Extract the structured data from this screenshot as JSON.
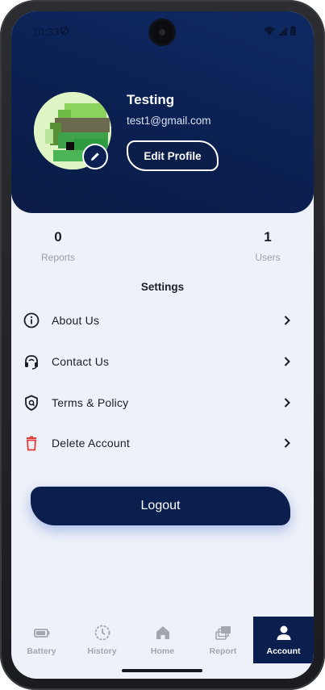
{
  "status_bar": {
    "time": "10:33"
  },
  "profile": {
    "name": "Testing",
    "email": "test1@gmail.com",
    "edit_label": "Edit Profile"
  },
  "stats": {
    "reports": {
      "value": "0",
      "label": "Reports"
    },
    "users": {
      "value": "1",
      "label": "Users"
    }
  },
  "settings": {
    "title": "Settings",
    "items": [
      {
        "label": "About Us",
        "icon": "info-icon"
      },
      {
        "label": "Contact Us",
        "icon": "headset-icon"
      },
      {
        "label": "Terms & Policy",
        "icon": "shield-icon"
      },
      {
        "label": "Delete Account",
        "icon": "trash-icon"
      }
    ]
  },
  "logout_label": "Logout",
  "nav": [
    {
      "label": "Battery",
      "icon": "battery-icon"
    },
    {
      "label": "History",
      "icon": "history-icon"
    },
    {
      "label": "Home",
      "icon": "home-icon"
    },
    {
      "label": "Report",
      "icon": "report-icon"
    },
    {
      "label": "Account",
      "icon": "account-icon",
      "active": true
    }
  ],
  "colors": {
    "primary": "#0b1f4f",
    "background": "#eef2f8",
    "danger": "#e53935",
    "muted": "#a1a6af"
  }
}
